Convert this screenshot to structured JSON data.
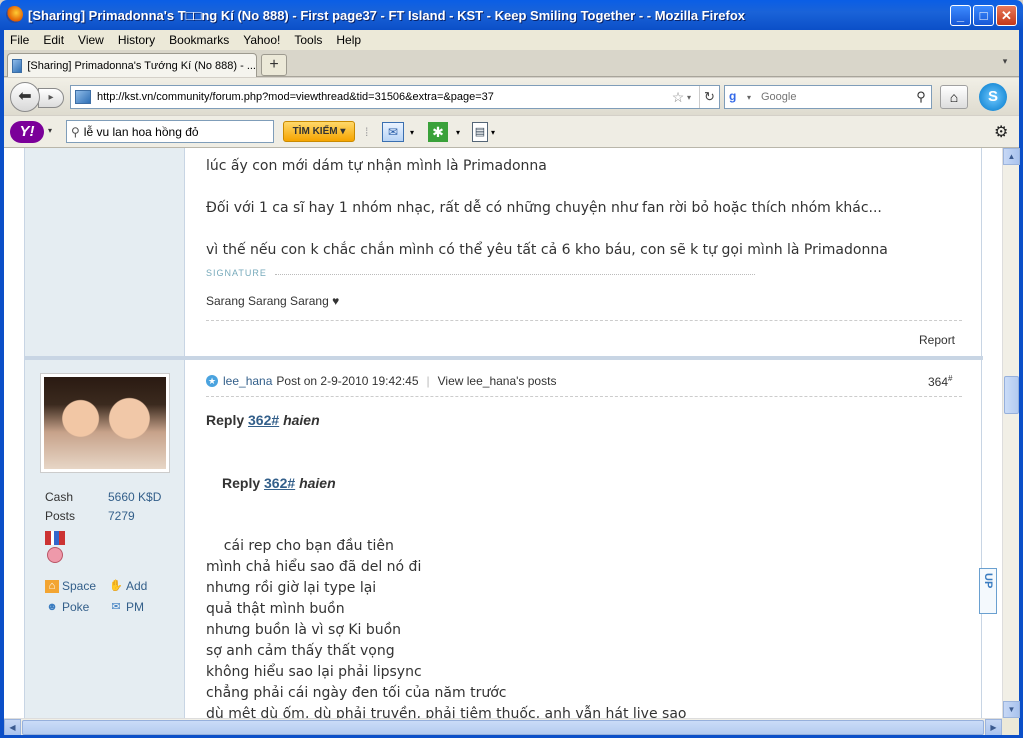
{
  "window": {
    "title": "[Sharing] Primadonna's T□□ng Kí (No 888) - First page37 - FT Island - KST - Keep Smiling Together - - Mozilla Firefox",
    "minimize": "_",
    "maximize": "□",
    "close": "✕"
  },
  "menu": [
    "File",
    "Edit",
    "View",
    "History",
    "Bookmarks",
    "Yahoo!",
    "Tools",
    "Help"
  ],
  "tab": {
    "label": "[Sharing] Primadonna's Tướng Kí (No 888) - ...",
    "new_tab": "+"
  },
  "nav": {
    "url": "http://kst.vn/community/forum.php?mod=viewthread&tid=31506&extra=&page=37",
    "search_placeholder": "Google",
    "search_engine_icon": "google-icon"
  },
  "yahoo": {
    "logo": "Y!",
    "search_value": "lễ vu lan hoa hồng đỏ",
    "search_button": "TÌM KIẾM ▾"
  },
  "prev_post": {
    "lines": [
      "lúc ấy con mới dám tự nhận mình là Primadonna",
      "Đối với 1 ca sĩ hay 1 nhóm nhạc, rất dễ có những chuyện như fan rời bỏ hoặc thích nhóm khác...",
      "vì thế nếu con k chắc chắn mình có thể yêu tất cả 6 kho báu, con sẽ k tự gọi mình là Primadonna"
    ],
    "signature_label": "SIGNATURE",
    "signature": "Sarang Sarang Sarang ♥",
    "report": "Report"
  },
  "user": {
    "cash_label": "Cash",
    "cash_value": "5660 K$D",
    "posts_label": "Posts",
    "posts_value": "7279",
    "links": {
      "space": "Space",
      "add": "Add",
      "poke": "Poke",
      "pm": "PM"
    }
  },
  "post": {
    "author": "lee_hana",
    "posted": "Post on 2-9-2010 19:42:45",
    "view_posts": "View lee_hana's posts",
    "floor": "364",
    "floor_sup": "#",
    "reply_word": "Reply",
    "reply_num": "362#",
    "reply_to": "haien",
    "lines": [
      "    cái rep cho bạn đầu tiên",
      "mình chả hiểu sao đã del nó đi",
      "nhưng rồi giờ lại type lại",
      "quả thật mình buồn",
      "nhưng buồn là vì sợ Ki buồn",
      "sợ anh cảm thấy thất vọng",
      "không hiểu sao lại phải lipsync",
      "chẳng phải cái ngày đen tối của năm trước",
      "dù mệt dù ốm, dù phải truyền, phải tiêm thuốc, anh vẫn hát live sao"
    ]
  },
  "up_button": "UP"
}
